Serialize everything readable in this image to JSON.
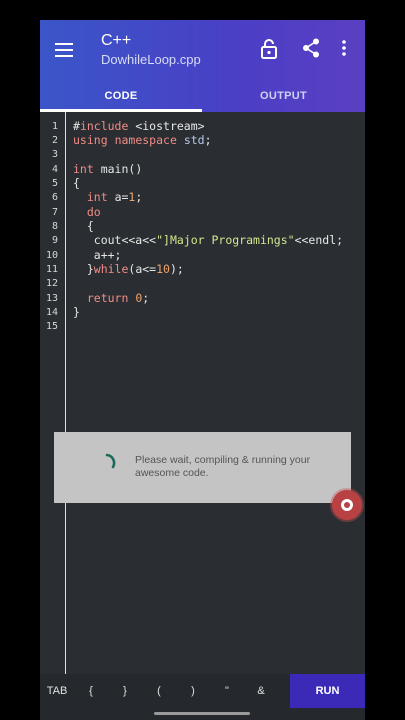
{
  "header": {
    "language": "C++",
    "filename": "DowhileLoop.cpp",
    "colors": {
      "appbar_start": "#3a56c8",
      "appbar_end": "#5b3fc2",
      "run_button": "#3b29b8",
      "fab": "#b84143"
    }
  },
  "tabs": [
    {
      "label": "CODE",
      "active": true
    },
    {
      "label": "OUTPUT",
      "active": false
    }
  ],
  "icons": [
    "menu-icon",
    "lock-icon",
    "share-icon",
    "more-vert-icon",
    "spinner-icon"
  ],
  "editor": {
    "line_numbers": [
      "1",
      "2",
      "3",
      "4",
      "5",
      "6",
      "7",
      "8",
      "9",
      "10",
      "11",
      "12",
      "13",
      "14",
      "15"
    ],
    "lines": [
      "#include <iostream>",
      "using namespace std;",
      "",
      "int main()",
      "{",
      "  int a=1;",
      "  do",
      "  {",
      "   cout<<a<<\"]Major Programings\"<<endl;",
      "   a++;",
      "  }while(a<=10);",
      "",
      "  return 0;",
      "}",
      ""
    ]
  },
  "toast": {
    "message": "Please wait, compiling & running your awesome code."
  },
  "keys": [
    "TAB",
    "{",
    "}",
    "(",
    ")",
    "\"",
    "&"
  ],
  "run_label": "RUN"
}
